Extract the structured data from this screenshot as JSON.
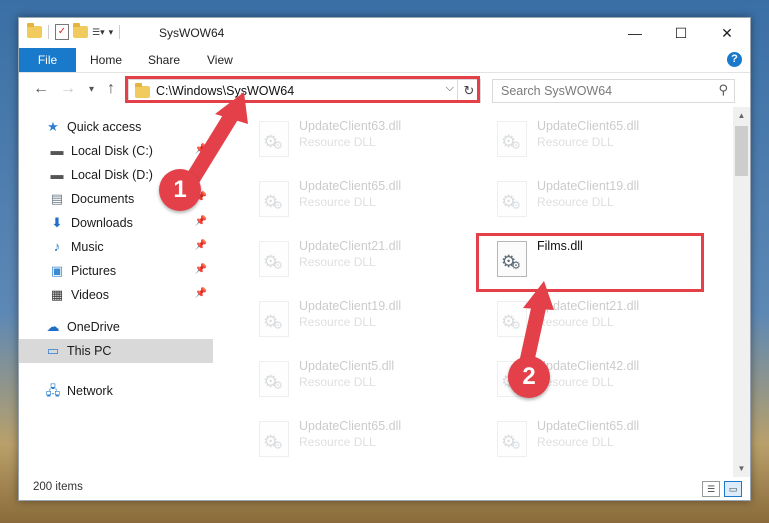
{
  "window": {
    "title": "SysWOW64"
  },
  "menu": {
    "file": "File",
    "home": "Home",
    "share": "Share",
    "view": "View",
    "help": "?"
  },
  "address": {
    "path": "C:\\Windows\\SysWOW64"
  },
  "search": {
    "placeholder": "Search SysWOW64"
  },
  "sidebar": {
    "items": [
      {
        "label": "Quick access",
        "icon": "star-icon",
        "pinned": false
      },
      {
        "label": "Local Disk (C:)",
        "icon": "drive-icon",
        "pinned": true
      },
      {
        "label": "Local Disk (D:)",
        "icon": "drive-icon",
        "pinned": true
      },
      {
        "label": "Documents",
        "icon": "documents-icon",
        "pinned": true
      },
      {
        "label": "Downloads",
        "icon": "download-icon",
        "pinned": true
      },
      {
        "label": "Music",
        "icon": "music-icon",
        "pinned": true
      },
      {
        "label": "Pictures",
        "icon": "pictures-icon",
        "pinned": true
      },
      {
        "label": "Videos",
        "icon": "videos-icon",
        "pinned": true
      },
      {
        "label": "OneDrive",
        "icon": "cloud-icon",
        "pinned": false
      },
      {
        "label": "This PC",
        "icon": "computer-icon",
        "pinned": false,
        "selected": true
      },
      {
        "label": "Network",
        "icon": "network-icon",
        "pinned": false
      }
    ]
  },
  "files": [
    {
      "name": "UpdateClient63.dll",
      "type": "Resource DLL"
    },
    {
      "name": "UpdateClient65.dll",
      "type": "Resource DLL"
    },
    {
      "name": "UpdateClient65.dll",
      "type": "Resource DLL"
    },
    {
      "name": "UpdateClient19.dll",
      "type": "Resource DLL"
    },
    {
      "name": "UpdateClient21.dll",
      "type": "Resource DLL"
    },
    {
      "name": "Films.dll",
      "type": "",
      "highlighted": true
    },
    {
      "name": "UpdateClient19.dll",
      "type": "Resource DLL"
    },
    {
      "name": "UpdateClient21.dll",
      "type": "Resource DLL"
    },
    {
      "name": "UpdateClient5.dll",
      "type": "Resource DLL"
    },
    {
      "name": "UpdateClient42.dll",
      "type": "Resource DLL"
    },
    {
      "name": "UpdateClient65.dll",
      "type": "Resource DLL"
    },
    {
      "name": "UpdateClient65.dll",
      "type": "Resource DLL"
    }
  ],
  "status": {
    "count": "200 items"
  },
  "callouts": {
    "one": "1",
    "two": "2"
  },
  "colors": {
    "accent": "#1979ca",
    "highlight": "#e3404a"
  }
}
